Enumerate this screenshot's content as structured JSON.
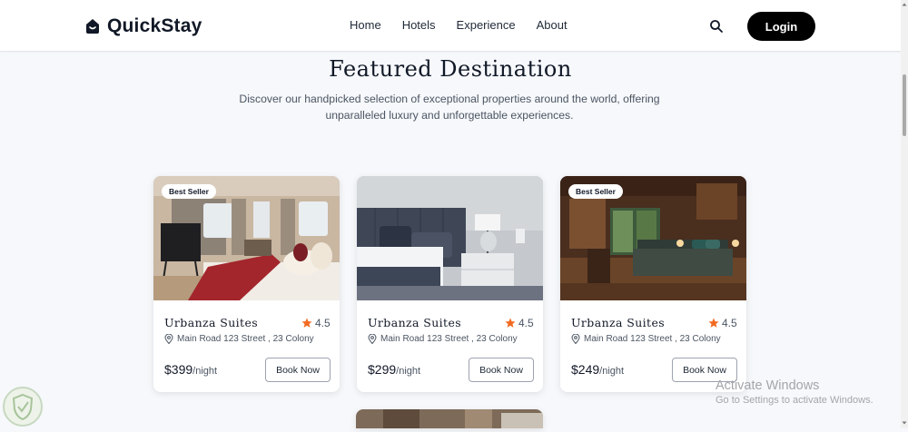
{
  "brand": {
    "name": "QuickStay"
  },
  "nav": {
    "links": [
      "Home",
      "Hotels",
      "Experience",
      "About"
    ],
    "login_label": "Login"
  },
  "section": {
    "title": "Featured Destination",
    "description": "Discover our handpicked selection of exceptional properties around the world, offering unparalleled luxury and unforgettable experiences."
  },
  "cards": [
    {
      "badge": "Best Seller",
      "name": "Urbanza Suites",
      "rating": "4.5",
      "address": "Main Road 123 Street , 23 Colony",
      "price": "$399",
      "price_unit": "/night",
      "cta": "Book Now",
      "image": "hotel-room-bright"
    },
    {
      "badge": "",
      "name": "Urbanza Suites",
      "rating": "4.5",
      "address": "Main Road 123 Street , 23 Colony",
      "price": "$299",
      "price_unit": "/night",
      "cta": "Book Now",
      "image": "hotel-room-grey"
    },
    {
      "badge": "Best Seller",
      "name": "Urbanza Suites",
      "rating": "4.5",
      "address": "Main Road 123 Street , 23 Colony",
      "price": "$249",
      "price_unit": "/night",
      "cta": "Book Now",
      "image": "hotel-room-wood"
    }
  ],
  "watermark": {
    "title": "Activate Windows",
    "subtitle": "Go to Settings to activate Windows."
  },
  "colors": {
    "accent": "#000000",
    "star": "#f26b21",
    "background": "#f6f8fb"
  },
  "icons": [
    "logo-icon",
    "search-icon",
    "star-icon",
    "location-pin-icon"
  ]
}
